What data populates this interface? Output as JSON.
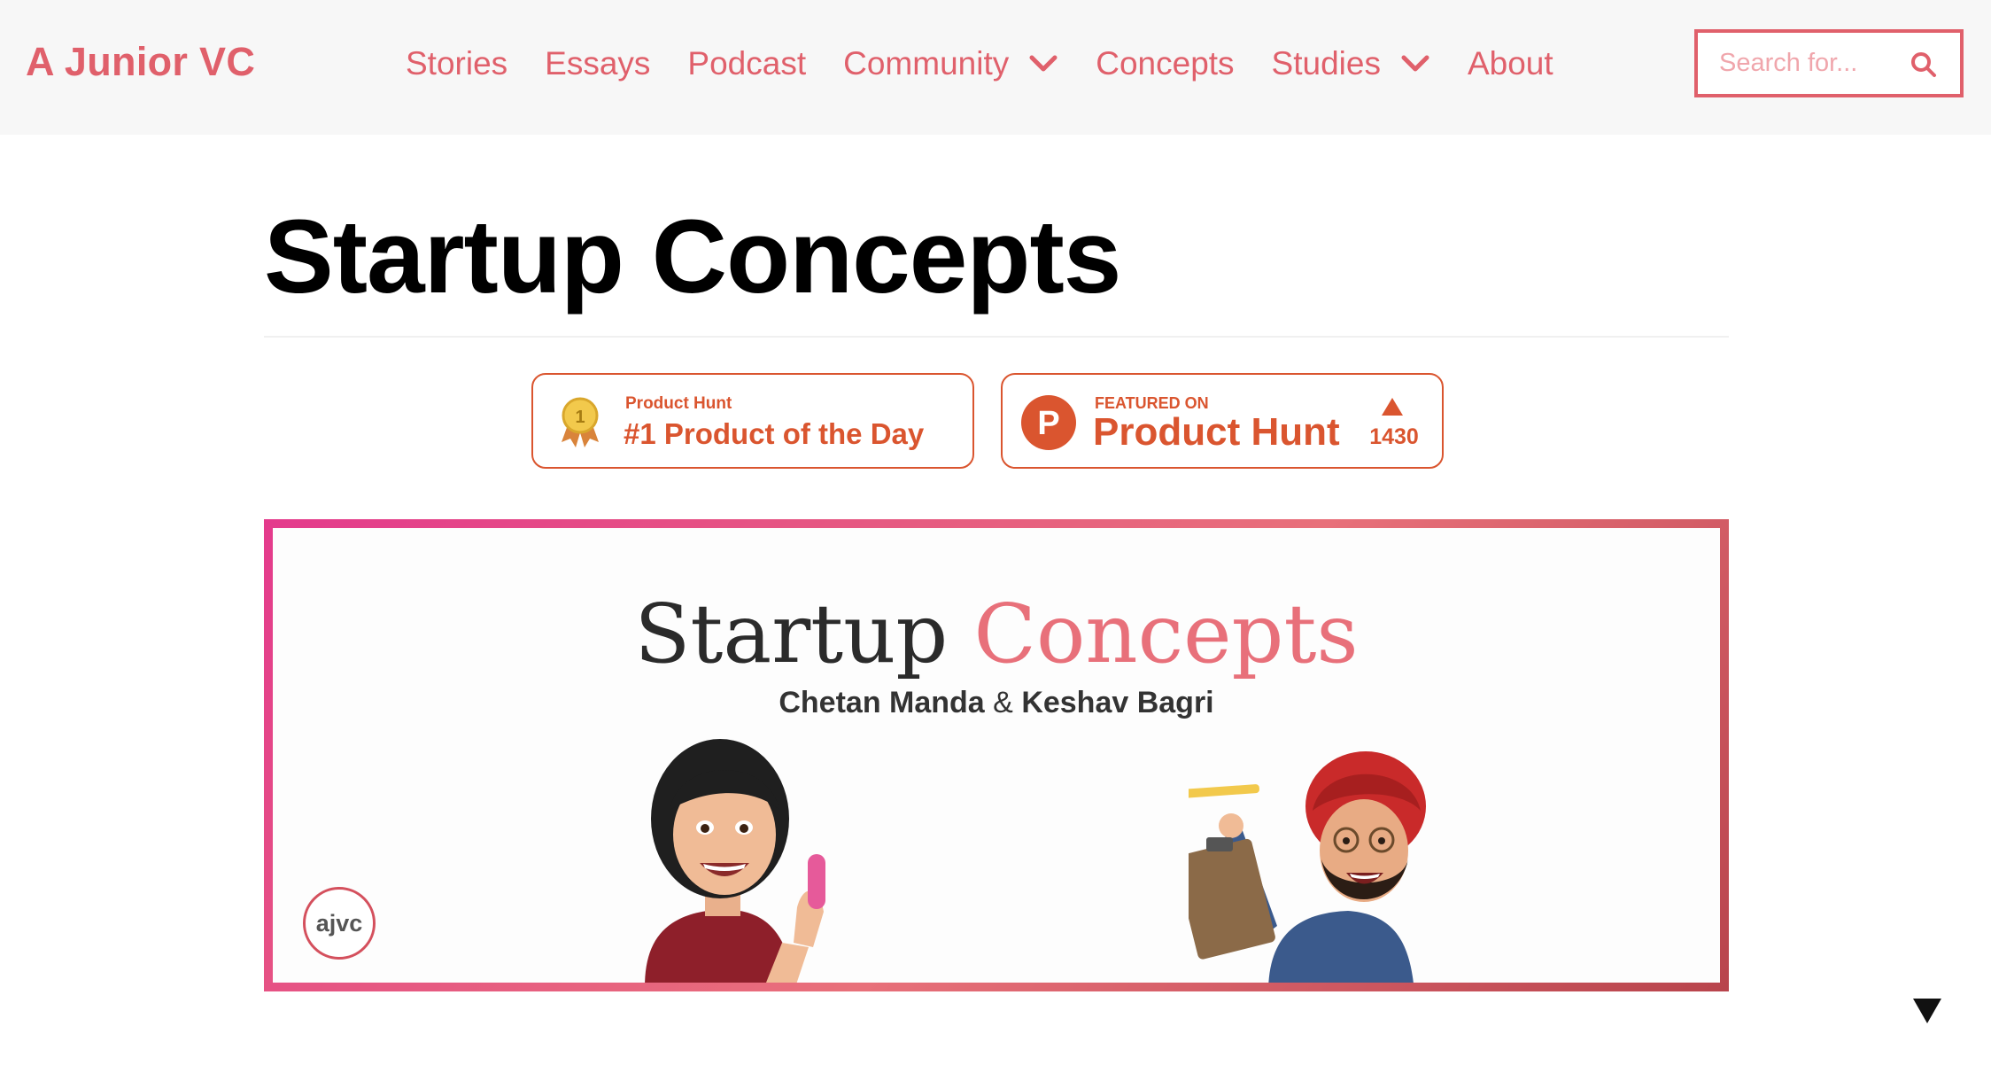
{
  "header": {
    "brand": "A Junior VC",
    "nav": [
      {
        "label": "Stories",
        "dropdown": false
      },
      {
        "label": "Essays",
        "dropdown": false
      },
      {
        "label": "Podcast",
        "dropdown": false
      },
      {
        "label": "Community",
        "dropdown": true
      },
      {
        "label": "Concepts",
        "dropdown": false
      },
      {
        "label": "Studies",
        "dropdown": true
      },
      {
        "label": "About",
        "dropdown": false
      }
    ],
    "search": {
      "placeholder": "Search for...",
      "value": ""
    }
  },
  "page": {
    "title": "Startup Concepts"
  },
  "badges": {
    "product_of_day": {
      "small_text": "Product Hunt",
      "main_text": "#1 Product of the Day",
      "medal_number": "1"
    },
    "featured": {
      "small_text": "FEATURED ON",
      "main_text": "Product Hunt",
      "logo_letter": "P",
      "votes": "1430"
    }
  },
  "banner": {
    "title_part1": "Startup",
    "title_part2": "Concepts",
    "author1": "Chetan Manda",
    "amp": "&",
    "author2": "Keshav Bagri",
    "logo_text": "ajvc"
  },
  "colors": {
    "accent": "#e0606b",
    "producthunt": "#da552f",
    "header_bg": "#f7f7f7",
    "banner_pink": "#e8707a"
  },
  "icons": {
    "search": "search-icon",
    "dropdown": "chevron-down-icon",
    "medal": "medal-icon",
    "producthunt": "producthunt-logo-icon",
    "upvote": "upvote-triangle-icon",
    "scroll": "scroll-down-triangle-icon"
  }
}
